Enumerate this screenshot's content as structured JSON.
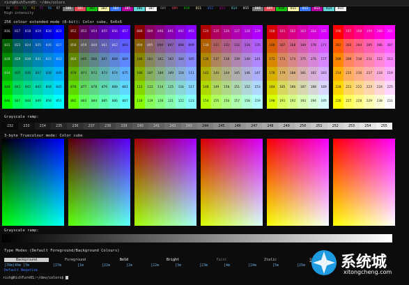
{
  "window": {
    "title": "rich@RichTurn05: ~/dev/colors"
  },
  "top_swatches": [
    {
      "label": "00",
      "bg": "#000000",
      "fg": "#888888"
    },
    {
      "label": "91",
      "bg": "#0c0c0c",
      "fg": "#c50f1f"
    },
    {
      "label": "92",
      "bg": "#0c0c0c",
      "fg": "#13a10e"
    },
    {
      "label": "93",
      "bg": "#0c0c0c",
      "fg": "#c19c00"
    },
    {
      "label": "95",
      "bg": "#0c0c0c",
      "fg": "#881798"
    },
    {
      "label": "96",
      "bg": "#0c0c0c",
      "fg": "#3a96dd"
    },
    {
      "label": "97",
      "bg": "#0c0c0c",
      "fg": "#cccccc"
    },
    {
      "label": "100",
      "bg": "#767676",
      "fg": "#ffffff"
    },
    {
      "label": "101",
      "bg": "#e74856",
      "fg": "#ffffff"
    },
    {
      "label": "102",
      "bg": "#16c60c",
      "fg": "#000000"
    },
    {
      "label": "103",
      "bg": "#f9f1a5",
      "fg": "#000000"
    },
    {
      "label": "104",
      "bg": "#3b78ff",
      "fg": "#ffffff"
    },
    {
      "label": "105",
      "bg": "#b4009e",
      "fg": "#ffffff"
    },
    {
      "label": "106",
      "bg": "#61d6d6",
      "fg": "#000000"
    },
    {
      "label": "107",
      "bg": "#f2f2f2",
      "fg": "#000000"
    },
    {
      "label": "000",
      "bg": "#0c0c0c",
      "fg": "#888888"
    },
    {
      "label": "009",
      "bg": "#0c0c0c",
      "fg": "#e74856"
    },
    {
      "label": "010",
      "bg": "#0c0c0c",
      "fg": "#16c60c"
    },
    {
      "label": "011",
      "bg": "#0c0c0c",
      "fg": "#f9f1a5"
    },
    {
      "label": "012",
      "bg": "#0c0c0c",
      "fg": "#3b78ff"
    },
    {
      "label": "013",
      "bg": "#0c0c0c",
      "fg": "#b4009e"
    },
    {
      "label": "014",
      "bg": "#0c0c0c",
      "fg": "#61d6d6"
    },
    {
      "label": "015",
      "bg": "#0c0c0c",
      "fg": "#f2f2f2"
    },
    {
      "label": "008",
      "bg": "#767676",
      "fg": "#ffffff"
    },
    {
      "label": "009",
      "bg": "#e74856",
      "fg": "#ffffff"
    },
    {
      "label": "010",
      "bg": "#16c60c",
      "fg": "#000000"
    },
    {
      "label": "011",
      "bg": "#f9f1a5",
      "fg": "#000000"
    },
    {
      "label": "012",
      "bg": "#3b78ff",
      "fg": "#ffffff"
    },
    {
      "label": "013",
      "bg": "#b4009e",
      "fg": "#ffffff"
    },
    {
      "label": "014",
      "bg": "#61d6d6",
      "fg": "#000000"
    },
    {
      "label": "015",
      "bg": "#f2f2f2",
      "fg": "#000000"
    }
  ],
  "high_intensity_label": "High intensity",
  "cube_section_title": "256 colour extended mode (8-bit): Color cube, 6x6x6",
  "grayscale_title": "Grayscale ramp:",
  "grayscale_labels": [
    "232",
    "233",
    "234",
    "235",
    "236",
    "237",
    "238",
    "239",
    "240",
    "241",
    "242",
    "243",
    "244",
    "245",
    "246",
    "247",
    "248",
    "249",
    "250",
    "251",
    "252",
    "253",
    "254",
    "255"
  ],
  "truecolor_title": "3-byte Truecolour mode: Color cube",
  "grayscale_ramp_title_2": "Grayscale ramp:",
  "type_modes_title": "Type Modes (Default Foreground/Background Colours)",
  "type_modes": [
    "Background",
    "Foreground",
    "Bold",
    "Bright",
    "Faint",
    "Italic",
    "Underline",
    "Blink"
  ],
  "type_codes": [
    "[39m[49m [7m",
    "[27m",
    "[1m",
    "[22m",
    "[2m",
    "[22m",
    "[3m",
    "[23m",
    "[4m",
    "[24m",
    "[5m",
    "[25m"
  ],
  "default_hint": "Default Negative",
  "prompt": "rich@RichTurn01:~/dev/colors$",
  "watermark": {
    "brand": "系统城",
    "url": "xitongcheng.com"
  }
}
